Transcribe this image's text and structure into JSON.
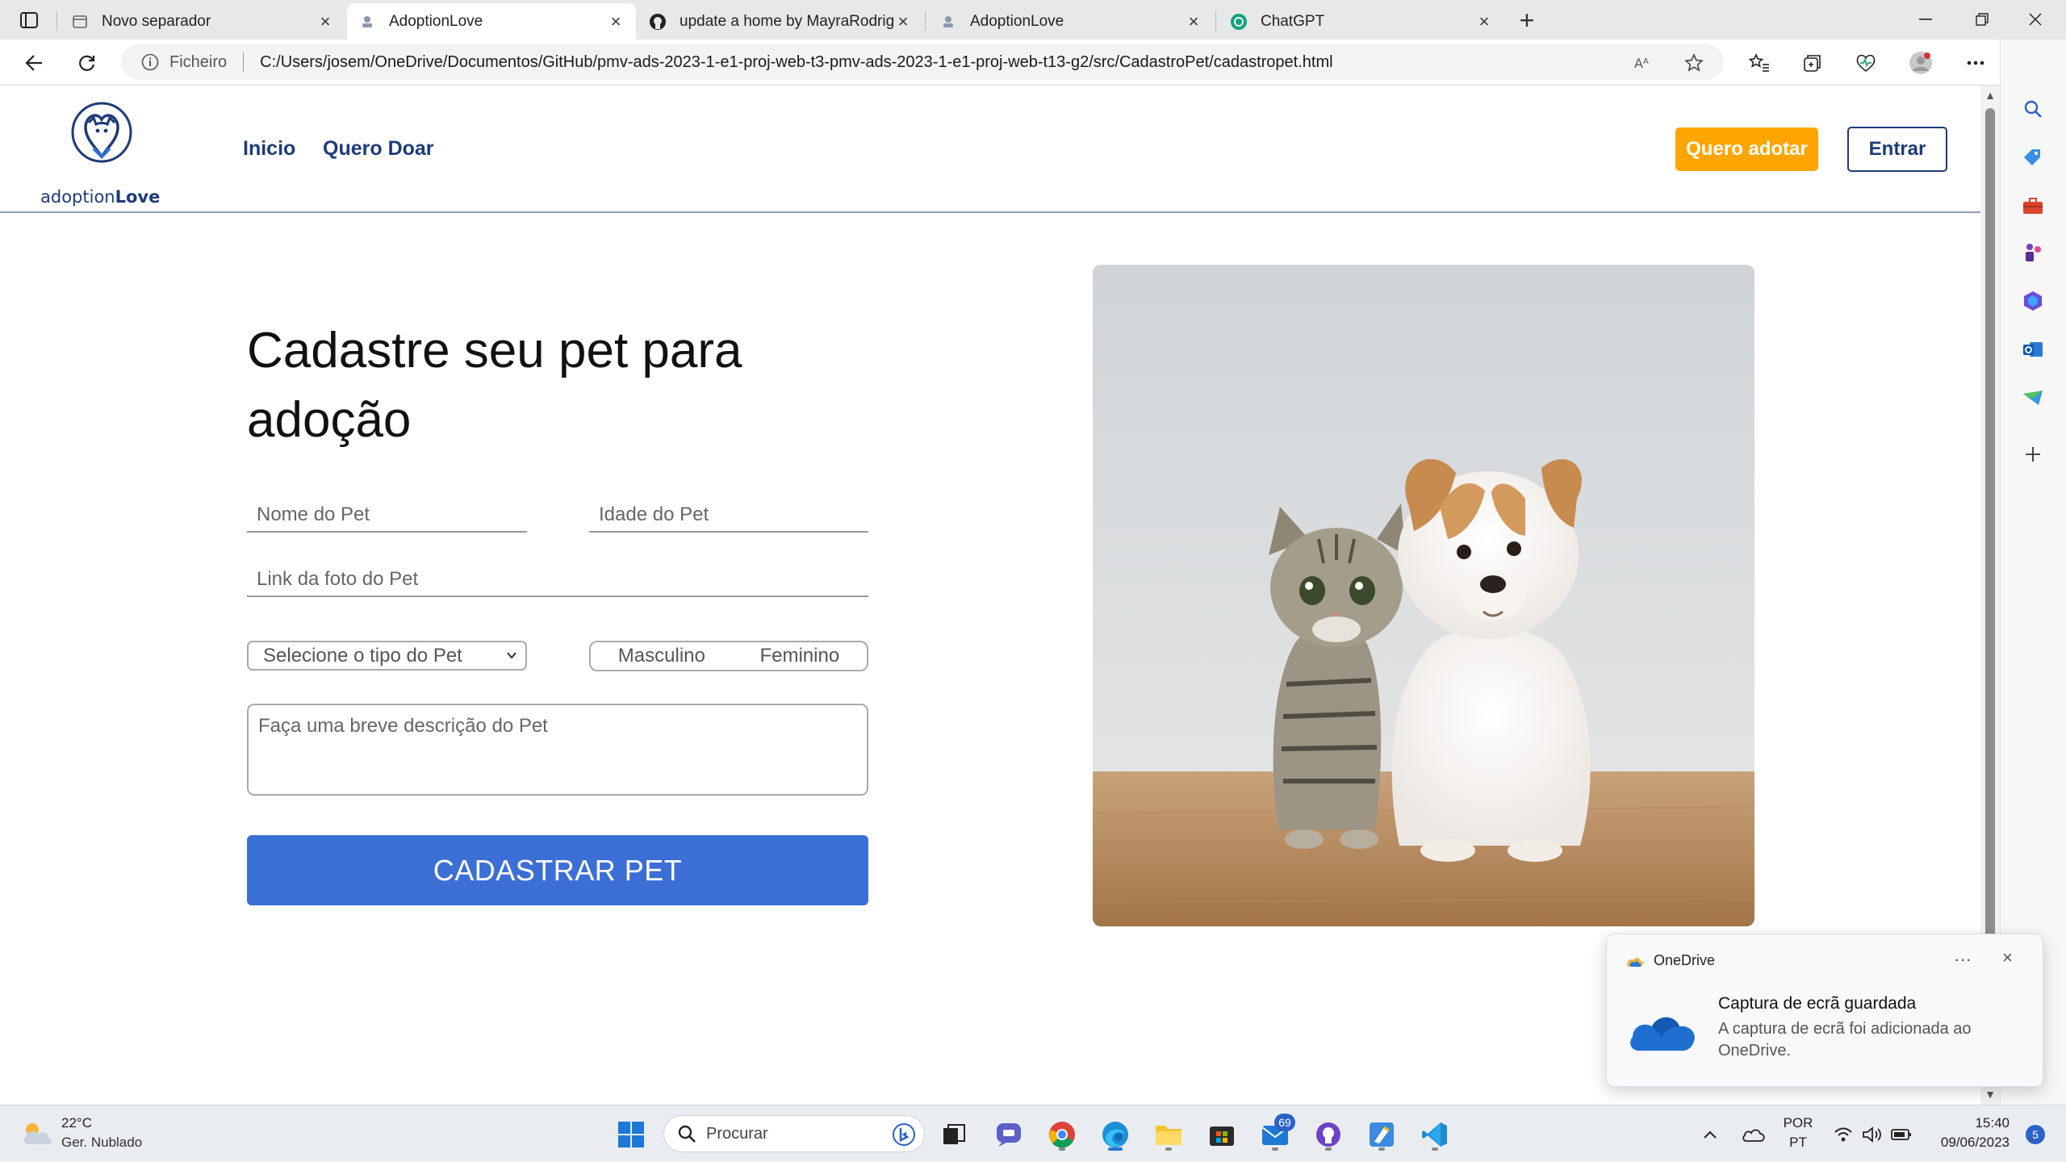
{
  "browser": {
    "tabs": [
      {
        "title": "Novo separador",
        "active": false
      },
      {
        "title": "AdoptionLove",
        "active": true
      },
      {
        "title": "update a home by MayraRodrigu",
        "active": false
      },
      {
        "title": "AdoptionLove",
        "active": false
      },
      {
        "title": "ChatGPT",
        "active": false
      }
    ],
    "address": {
      "scheme_label": "Ficheiro",
      "url": "C:/Users/josem/OneDrive/Documentos/GitHub/pmv-ads-2023-1-e1-proj-web-t3-pmv-ads-2023-1-e1-proj-web-t13-g2/src/CadastroPet/cadastropet.html"
    }
  },
  "site": {
    "logo_text_plain": "adoption",
    "logo_text_bold": "Love",
    "nav": [
      {
        "label": "Inicio"
      },
      {
        "label": "Quero Doar"
      }
    ],
    "adopt_button": "Quero adotar",
    "login_button": "Entrar"
  },
  "form": {
    "title": "Cadastre seu pet para adoção",
    "pet_name_placeholder": "Nome do Pet",
    "pet_age_placeholder": "Idade do Pet",
    "photo_link_placeholder": "Link da foto do Pet",
    "pet_type_selected": "Selecione o tipo do Pet",
    "gender_options": [
      "Masculino",
      "Feminino"
    ],
    "description_placeholder": "Faça uma breve descrição do Pet",
    "submit_label": "CADASTRAR PET"
  },
  "toast": {
    "app_name": "OneDrive",
    "title": "Captura de ecrã guardada",
    "body": "A captura de ecrã foi adicionada ao OneDrive."
  },
  "taskbar": {
    "weather_temp": "22°C",
    "weather_desc": "Ger. Nublado",
    "search_label": "Procurar",
    "mail_badge": "69",
    "language_line1": "POR",
    "language_line2": "PT",
    "time": "15:40",
    "date": "09/06/2023",
    "notifications": "5"
  },
  "colors": {
    "brand_navy": "#1d3b7a",
    "accent_orange": "#ffa500",
    "submit_blue": "#3c6fd6"
  }
}
